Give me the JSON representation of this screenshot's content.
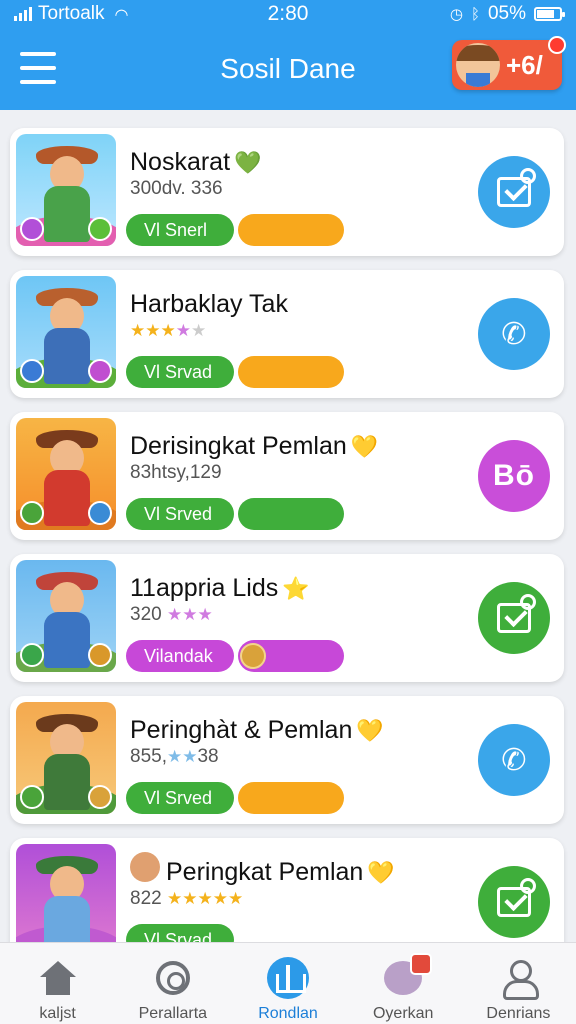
{
  "status_bar": {
    "carrier": "Tortoalk",
    "time": "2:80",
    "battery": "05%"
  },
  "header": {
    "title": "Sosil Dane",
    "promo_count": "+6/"
  },
  "list": [
    {
      "title": "Noskarat",
      "title_emoji": "💚",
      "subtitle": "300dv. 336",
      "pill_a": "Vl Snerl",
      "pill_b": "",
      "pill_b_color": "orange",
      "action": "check-blue"
    },
    {
      "title": "Harbaklay Tak",
      "title_emoji": "",
      "subtitle": "",
      "stars": "★★★★★",
      "pill_a": "Vl Srvad",
      "pill_b": "",
      "pill_b_color": "orange",
      "action": "phone"
    },
    {
      "title": "Derisingkat Pemlan",
      "title_emoji": "💛",
      "subtitle": "83htsy,129",
      "pill_a": "Vl Srved",
      "pill_b": "",
      "pill_b_color": "green",
      "action": "bo",
      "action_text": "Bō"
    },
    {
      "title": "11apprіa Lids",
      "title_emoji": "⭐",
      "subtitle": "320",
      "stars": "★★★",
      "pill_a": "Vilandak",
      "pill_b": "",
      "pill_b_color": "purple",
      "action": "check-green"
    },
    {
      "title": "Peringhàt & Pemlan",
      "title_emoji": "💛",
      "subtitle": "855,",
      "subtitle_tail": "38",
      "stars": "★★",
      "pill_a": "Vl Srved",
      "pill_b": "",
      "pill_b_color": "orange",
      "action": "phone"
    },
    {
      "title": "Peringkat Pemlan",
      "title_emoji": "💛",
      "subtitle": "822",
      "stars": "★★★★★",
      "pill_a": "Vl Srvad",
      "pill_b": "",
      "pill_b_color": "orange",
      "action": "check-green"
    }
  ],
  "tabs": [
    {
      "label": "kaljst",
      "icon": "home-icon"
    },
    {
      "label": "Perallarta",
      "icon": "target-icon"
    },
    {
      "label": "Rondlan",
      "icon": "central-icon",
      "active": true
    },
    {
      "label": "Oyerkan",
      "icon": "social-icon"
    },
    {
      "label": "Denrians",
      "icon": "profile-icon"
    }
  ],
  "colors": {
    "primary": "#2f9ef0",
    "green": "#3fae3b",
    "orange": "#f8a81c",
    "purple": "#c748d8"
  }
}
